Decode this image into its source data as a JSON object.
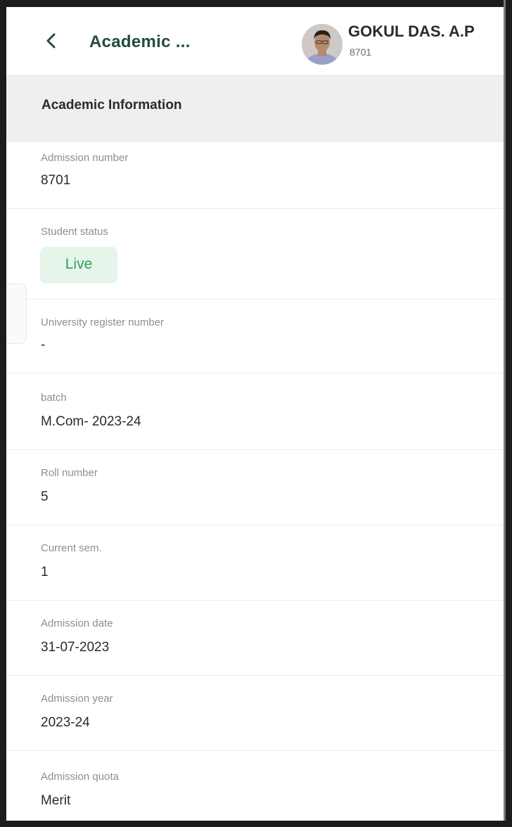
{
  "header": {
    "title": "Academic ...",
    "user_name": "GOKUL DAS. A.P",
    "user_id": "8701"
  },
  "section": {
    "title": "Academic Information"
  },
  "fields": [
    {
      "label": "Admission number",
      "value": "8701"
    },
    {
      "label": "Student status",
      "value": "Live"
    },
    {
      "label": "University register number",
      "value": "-"
    },
    {
      "label": "batch",
      "value": "M.Com- 2023-24"
    },
    {
      "label": "Roll number",
      "value": "5"
    },
    {
      "label": "Current sem.",
      "value": "1"
    },
    {
      "label": "Admission date",
      "value": "31-07-2023"
    },
    {
      "label": "Admission year",
      "value": "2023-24"
    },
    {
      "label": "Admission quota",
      "value": "Merit"
    }
  ],
  "colors": {
    "accent": "#1f4d3f",
    "status_bg": "#e6f4ea",
    "status_text": "#2ea354",
    "section_bg": "#efefef"
  },
  "icons": {
    "back": "chevron-left-icon",
    "avatar": "user-photo"
  }
}
